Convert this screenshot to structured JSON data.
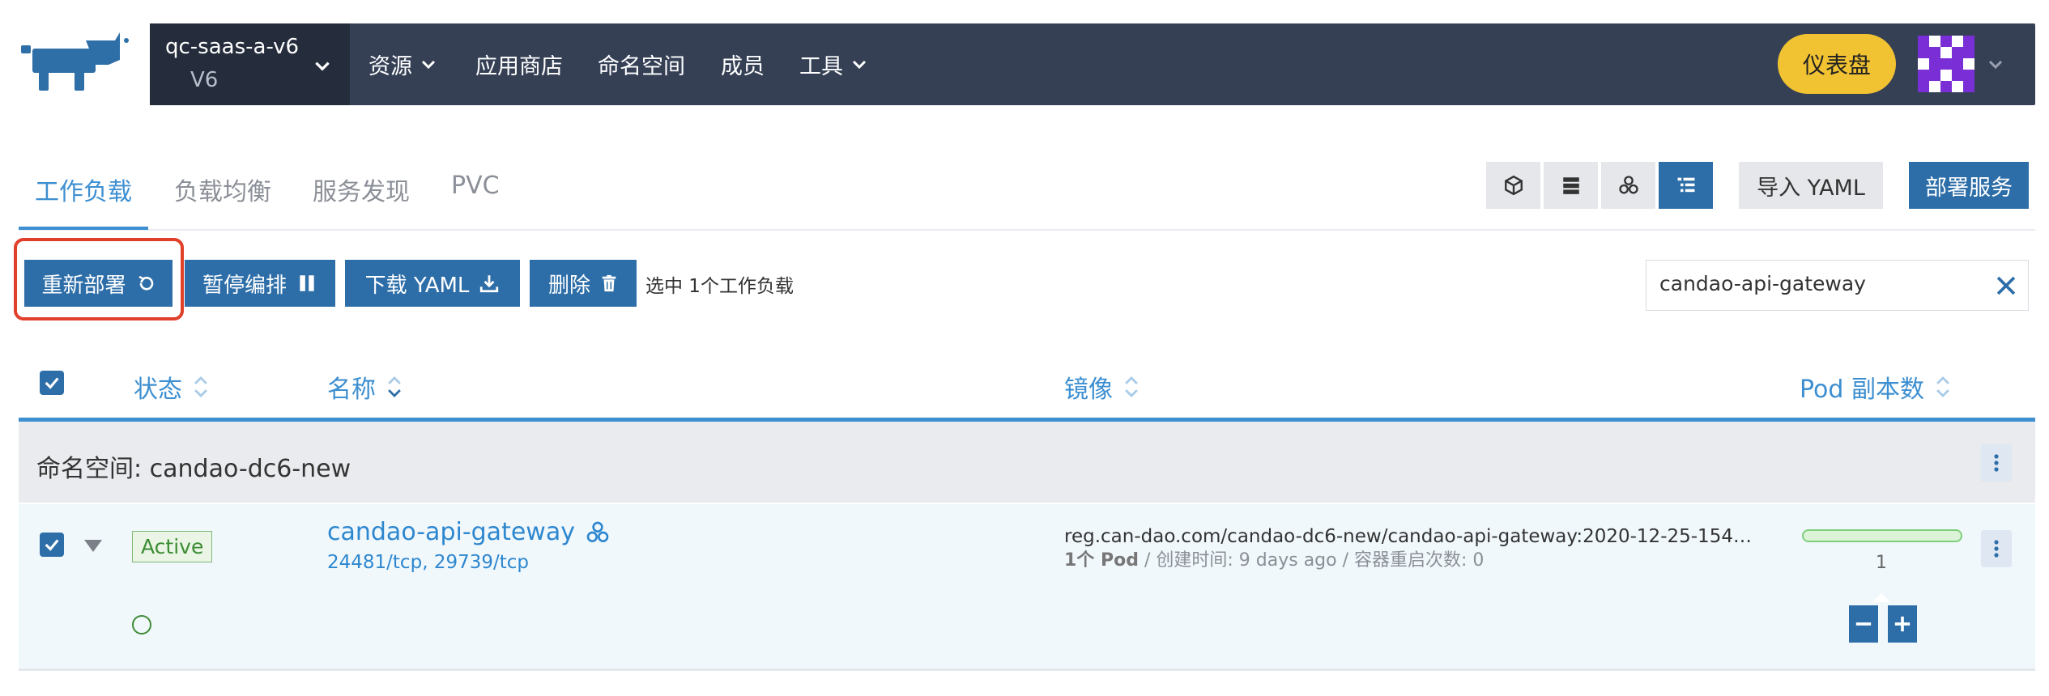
{
  "header": {
    "cluster_name": "qc-saas-a-v6",
    "cluster_version": "V6",
    "nav": [
      {
        "label": "资源",
        "has_dropdown": true
      },
      {
        "label": "应用商店",
        "has_dropdown": false
      },
      {
        "label": "命名空间",
        "has_dropdown": false
      },
      {
        "label": "成员",
        "has_dropdown": false
      },
      {
        "label": "工具",
        "has_dropdown": true
      }
    ],
    "dashboard_label": "仪表盘"
  },
  "tabs": [
    {
      "label": "工作负载",
      "active": true
    },
    {
      "label": "负载均衡",
      "active": false
    },
    {
      "label": "服务发现",
      "active": false
    },
    {
      "label": "PVC",
      "active": false
    }
  ],
  "view_modes": [
    "cube-icon",
    "list-rows-icon",
    "nodes-icon",
    "grouped-list-icon"
  ],
  "actions": {
    "import_yaml": "导入 YAML",
    "deploy_service": "部署服务",
    "redeploy": "重新部署",
    "pause": "暂停编排",
    "download_yaml": "下载 YAML",
    "delete": "删除",
    "selected_text": "选中 1个工作负载"
  },
  "search": {
    "value": "candao-api-gateway"
  },
  "table": {
    "headers": {
      "state": "状态",
      "name": "名称",
      "image": "镜像",
      "pods": "Pod 副本数"
    },
    "group": {
      "label": "命名空间: candao-dc6-new"
    },
    "rows": [
      {
        "state": "Active",
        "name": "candao-api-gateway",
        "port1": "24481/tcp",
        "port2": "29739/tcp",
        "image": "reg.can-dao.com/candao-dc6-new/candao-api-gateway:2020-12-25-1545...",
        "pod_label": "1个 Pod",
        "created": "创建时间: 9 days ago",
        "restarts": "容器重启次数: 0",
        "pod_count": "1",
        "pod_ready_fraction": 1.0
      }
    ]
  },
  "colors": {
    "header_bg": "#354055",
    "accent": "#2d6ea8",
    "link": "#3d8fd1",
    "dashboard": "#f1c232",
    "active_green": "#3c8c33",
    "highlight_red": "#e0402a"
  }
}
